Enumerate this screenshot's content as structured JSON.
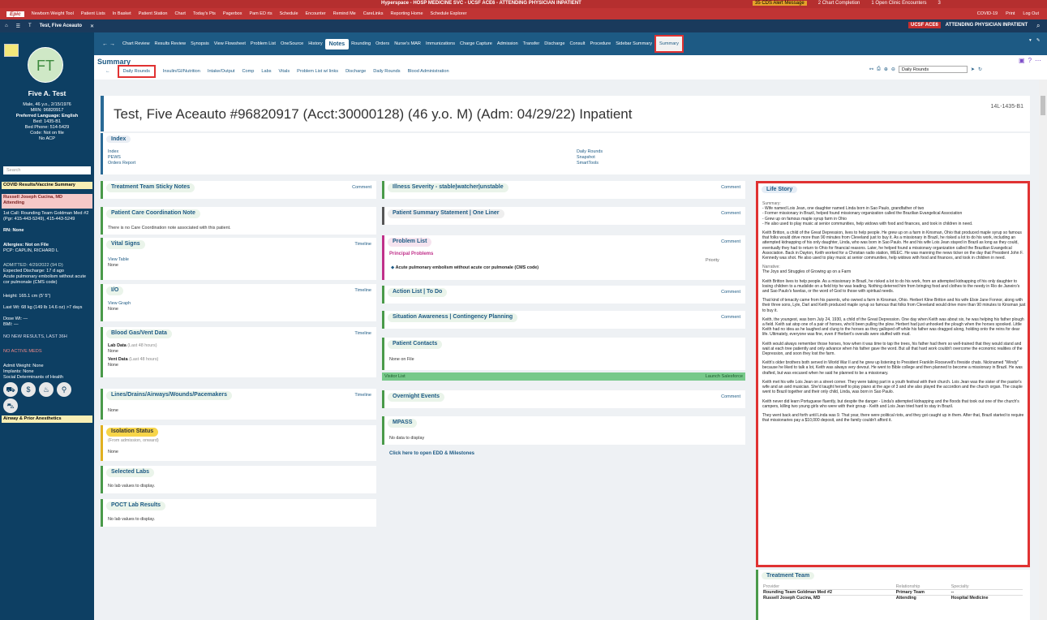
{
  "window": {
    "title": "Hyperspace - HOSP MEDICINE SVC - UCSF ACE6 - ATTENDING PHYSICIAN INPATIENT"
  },
  "titlebar_right": {
    "alert": "35 CDS Alert Message",
    "chart_completion": "2 Chart Completion",
    "open_encounters": "1 Open Clinic Encounters",
    "extra": "3"
  },
  "toolbar": {
    "logo": "Epic",
    "items": [
      "Newborn Weight Tool",
      "Patient Lists",
      "In Basket",
      "Patient Station",
      "Chart",
      "Today's Pts",
      "Pagerbox",
      "Pam ED rts",
      "Schedule",
      "Encounter",
      "Remind Me",
      "CareLinks",
      "Reporting Home",
      "Schedule Explorer"
    ],
    "right": [
      "COVID-19",
      "Print",
      "Log Out"
    ]
  },
  "patient_bar": {
    "name": "Test, Five Aceauto",
    "dept": "UCSF ACE6",
    "role": "ATTENDING PHYSICIAN INPATIENT"
  },
  "sidebar": {
    "initials": "FT",
    "name": "Five A. Test",
    "demo": "Male, 46 y.o., 2/15/1976",
    "mrn": "MRN: 96820917",
    "language": "Preferred Language: English",
    "bed": "Bed: 1435-B1",
    "bed_phone": "Bed Phone: 514-5429",
    "code": "Code: Not on file",
    "acp": "No ACP",
    "search_placeholder": "Search",
    "covid": "COVID Results/Vaccine Summary",
    "attending_name": "Russell Joseph Cucina, MD",
    "attending_role": "Attending",
    "first_call": "1st Call: Rounding Team Goldman Med #2 (Pgr: 415-443-5249), 415-443-5249",
    "rn": "RN: None",
    "allergies": "Allergies: Not on File",
    "pcp": "PCP: CAPLIN, RICHARD L",
    "admitted": "ADMITTED: 4/29/2022 (94 D)",
    "discharge": "Expected Discharge: 17 d ago",
    "problem": "Acute pulmonary embolism without acute cor pulmonale (CMS code)",
    "height": "Height: 165.1 cm (5' 5\")",
    "weight": "Last Wt: 68 kg (149 lb 14.6 oz) >7 days",
    "dose_wt": "Dose Wt: —",
    "bmi": "BMI: —",
    "results": "NO NEW RESULTS, LAST 36H",
    "meds": "NO ACTIVE MEDS",
    "weight_bearing": "Admit Weight: None",
    "implants": "Implants: None",
    "sdoh": "Social Determinants of Health",
    "airway": "Airway & Prior Anesthetics"
  },
  "tabs": [
    "Chart Review",
    "Results Review",
    "Synopsis",
    "View Flowsheet",
    "Problem List",
    "OneSource",
    "History",
    "Notes",
    "Rounding",
    "Orders",
    "Nurse's MAR",
    "Immunizations",
    "Charge Capture",
    "Admission",
    "Transfer",
    "Discharge",
    "Consult",
    "Procedure",
    "Sidebar Summary",
    "Summary"
  ],
  "activity": {
    "title": "Summary",
    "subtabs": [
      "Daily Rounds",
      "Insulin/GI/Nutrition",
      "Intake/Output",
      "Comp",
      "Labs",
      "Vitals",
      "Problem List w/ links",
      "Discharge",
      "Daily Rounds",
      "Blood Administration"
    ],
    "report_select": "Daily Rounds"
  },
  "header": {
    "title": "Test, Five Aceauto #96820917 (Acct:30000128) (46 y.o. M) (Adm: 04/29/22) Inpatient",
    "room": "14L-1435-B1"
  },
  "index": {
    "title": "Index",
    "left": [
      "Index",
      "PEWS",
      "Orders Report"
    ],
    "right": [
      "Daily Rounds",
      "Snapshot",
      "SmartTools"
    ]
  },
  "left_col": {
    "sticky": {
      "title": "Treatment Team Sticky Notes",
      "comment": "Comment"
    },
    "coord": {
      "title": "Patient Care Coordination Note",
      "body": "There is no Care Coordination note associated with this patient."
    },
    "vitals": {
      "title": "Vital Signs",
      "timeline": "Timeline",
      "link": "View Table",
      "body": "None"
    },
    "io": {
      "title": "I/O",
      "timeline": "Timeline",
      "link": "View Graph",
      "body": "None"
    },
    "blood_gas": {
      "title": "Blood Gas/Vent Data",
      "timeline": "Timeline",
      "lab": "Lab Data",
      "lab_sub": "(Last 48 hours)",
      "lab_val": "None",
      "vent": "Vent Data",
      "vent_sub": "(Last 48 hours)",
      "vent_val": "None"
    },
    "lines": {
      "title": "Lines/Drains/Airways/Wounds/Pacemakers",
      "timeline": "Timeline",
      "body": "None"
    },
    "isolation": {
      "title": "Isolation Status",
      "sub": "(From admission, onward)",
      "body": "None"
    },
    "labs": {
      "title": "Selected Labs",
      "body": "No lab values to display."
    },
    "poct": {
      "title": "POCT Lab Results",
      "body": "No lab values to display."
    }
  },
  "mid_col": {
    "illness": {
      "title": "Illness Severity - stable|watcher|unstable",
      "comment": "Comment"
    },
    "oneliner": {
      "title": "Patient Summary Statement | One Liner",
      "comment": "Comment"
    },
    "problems": {
      "title": "Problem List",
      "comment": "Comment",
      "sub": "Principal Problems",
      "priority": "Priority",
      "item": "Acute pulmonary embolism without acute cor pulmonale (CMS code)"
    },
    "action": {
      "title": "Action List | To Do",
      "comment": "Comment"
    },
    "situation": {
      "title": "Situation Awareness | Contingency Planning",
      "comment": "Comment"
    },
    "contacts": {
      "title": "Patient Contacts",
      "body": "None on File"
    },
    "visitor": {
      "label": "Visitor List",
      "link": "Launch Salesforce"
    },
    "overnight": {
      "title": "Overnight Events",
      "comment": "Comment"
    },
    "mpass": {
      "title": "MPASS",
      "body": "No data to display"
    },
    "edd": "Click here to open EDD & Milestones"
  },
  "life_story": {
    "title": "Life Story",
    "summary_label": "Summary:",
    "summary": [
      "- Wife named Lois Jean, one daughter named Linda born in Sao Paulo, grandfather of two",
      "- Former missionary in Brazil, helped found missionary organization called the Brazilian Evangelical Association",
      "- Grew up on famous maple syrup farm in Ohio",
      "- He also used to play music at senior communities, help widows with food and finances, and took in children in need."
    ],
    "p1": "Keith Britton, a child of the Great Depression, lives to help people. He grew up on a farm in Kinsman, Ohio that produced maple syrup so famous that folks would drive more than 90 minutes from Cleveland just to buy it. As a missionary in Brazil, he risked a lot to do his work, including an attempted kidnapping of his only daughter, Linda, who was born in Sao Paulo. He and his wife Lois Jean stayed in Brazil as long as they could, eventually they had to return to Ohio for financial reasons. Later, he helped found a missionary organization called the Brazilian Evangelical Association. Back in Dayton, Keith worked for a Christian radio station, WEEC. He was manning the news ticker on the day that President John F. Kennedy was shot. He also used to play music at senior communities, help widows with food and finances, and took in children in need.",
    "narrative_label": "Narrative:",
    "narrative_title": "The Joys and Struggles of Growing up on a Farm",
    "p2": "Keith Britton lives to help people. As a missionary in Brazil, he risked a lot to do his work, from an attempted kidnapping of his only daughter to losing children to a mudslide on a field trip he was leading. Nothing deterred him from bringing food and clothes to the needy in Rio de Janeiro's and Sao Paulo's favelas, or the word of God to those with spiritual needs.",
    "p3": "That kind of tenacity came from his parents, who owned a farm in Kinsman, Ohio. Herbert Kline Britton and his wife Elsie Jane Fonnor, along with their three sons, Lyle, Darl and Keith produced maple syrup so famous that folks from Cleveland would drive more than 90 minutes to Kinsman just to buy it.",
    "p4": "Keith, the youngest, was born July 24, 1930, a child of the Great Depression. One day when Keith was about six, he was helping his father plough a field. Keith sat atop one of a pair of horses, who'd been pulling the plow. Herbert had just unhooked the plough when the horses spooked. Little Keith had no idea as he laughed and clung to the horses as they galloped off while his father was dragged along, holding onto the reins for dear life. Ultimately, everyone was fine, even if Herbert's overalls were stuffed with mud.",
    "p5": "Keith would always remember those horses, how when it was time to tap the trees, his father had them so well-trained that they would stand and wait at each tree patiently and only advance when his father gave the word. But all that hard work couldn't overcome the economic realities of the Depression, and soon they lost the farm.",
    "p6": "Keith's older brothers both served in World War II and he grew up listening to President Franklin Roosevelt's fireside chats. Nicknamed \"Windy\" because he liked to talk a lot, Keith was always very devout. He went to Bible college and then planned to become a missionary in Brazil. He was drafted, but was excused when he said he planned to be a missionary.",
    "p7": "Keith met his wife Lois Jean on a street corner. They were taking part in a youth festival with their church. Lois Jean was the sister of the pastor's wife and an avid musician. She'd taught herself to play piano at the age of 3 and she also played the accordion and the church organ. The couple went to Brazil together and their only child, Linda, was born in Sao Paulo.",
    "p8": "Keith never did learn Portuguese fluently, but despite the danger - Linda's attempted kidnapping and the floods that took out one of the church's campers, killing two young girls who were with their group - Keith and Lois Jean tried hard to stay in Brazil.",
    "p9": "They went back and forth until Linda was 9. That year, there were political riots, and they got caught up in them. After that, Brazil started to require that missionaries pay a $10,000 deposit, and the family couldn't afford it."
  },
  "treatment_team": {
    "title": "Treatment Team",
    "headers": [
      "Provider",
      "Relationship",
      "Specialty"
    ],
    "rows": [
      [
        "Rounding Team Goldman Med #2",
        "Primary Team",
        "--"
      ],
      [
        "Russell Joseph Cucina, MD",
        "Attending",
        "Hospital Medicine"
      ]
    ]
  }
}
